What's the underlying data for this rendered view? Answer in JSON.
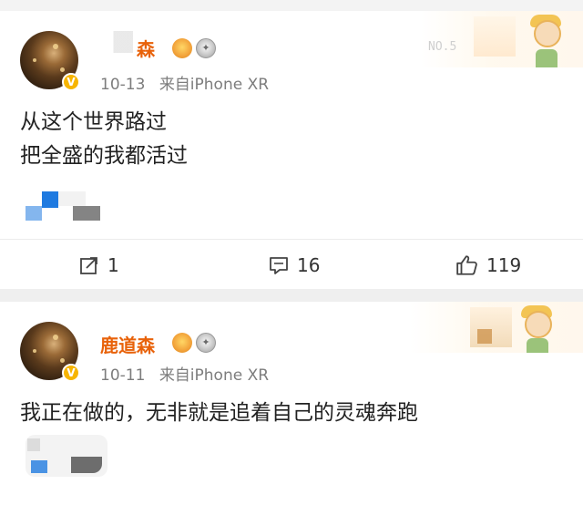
{
  "posts": [
    {
      "username_visible": "森",
      "deco_code": "NO.5",
      "timestamp": "10-13",
      "source": "来自iPhone XR",
      "content_lines": [
        "从这个世界路过",
        "把全盛的我都活过"
      ],
      "actions": {
        "repost_count": "1",
        "comment_count": "16",
        "like_count": "119"
      }
    },
    {
      "username": "鹿道森",
      "timestamp": "10-11",
      "source": "来自iPhone XR",
      "content_lines": [
        "我正在做的，无非就是追着自己的灵魂奔跑"
      ]
    }
  ],
  "icons": {
    "repost": "share-arrow-icon",
    "comment": "comment-bubble-icon",
    "like": "thumbs-up-icon",
    "verified": "verified-v-badge-icon",
    "crown": "crown-badge-icon",
    "medal": "medal-badge-icon"
  },
  "colors": {
    "username": "#e8620a",
    "meta": "#7d7d7d",
    "verified": "#f7b500",
    "mosaic_blue": "#1f7ae0",
    "background": "#efefef"
  }
}
